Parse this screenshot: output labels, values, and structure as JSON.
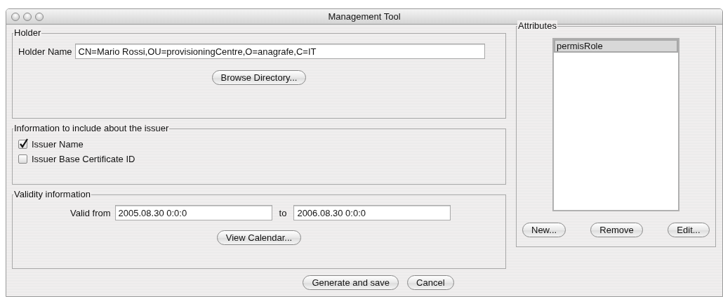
{
  "window": {
    "title": "Management Tool"
  },
  "holder": {
    "title": "Holder",
    "label": "Holder Name",
    "value": "CN=Mario Rossi,OU=provisioningCentre,O=anagrafe,C=IT",
    "button": "Browse Directory..."
  },
  "issuer": {
    "title": "Information to include about the issuer",
    "options": [
      {
        "label": "Issuer Name",
        "checked": true
      },
      {
        "label": "Issuer Base Certificate ID",
        "checked": false
      }
    ]
  },
  "validity": {
    "title": "Validity information",
    "from_label": "Valid from",
    "from_value": "2005.08.30 0:0:0",
    "to_label": "to",
    "to_value": "2006.08.30 0:0:0",
    "button": "View Calendar..."
  },
  "attributes": {
    "title": "Attributes",
    "items": [
      {
        "label": "permisRole",
        "selected": true
      }
    ],
    "buttons": [
      "New...",
      "Remove",
      "Edit..."
    ]
  },
  "buttons": [
    "Generate and save",
    "Cancel"
  ]
}
